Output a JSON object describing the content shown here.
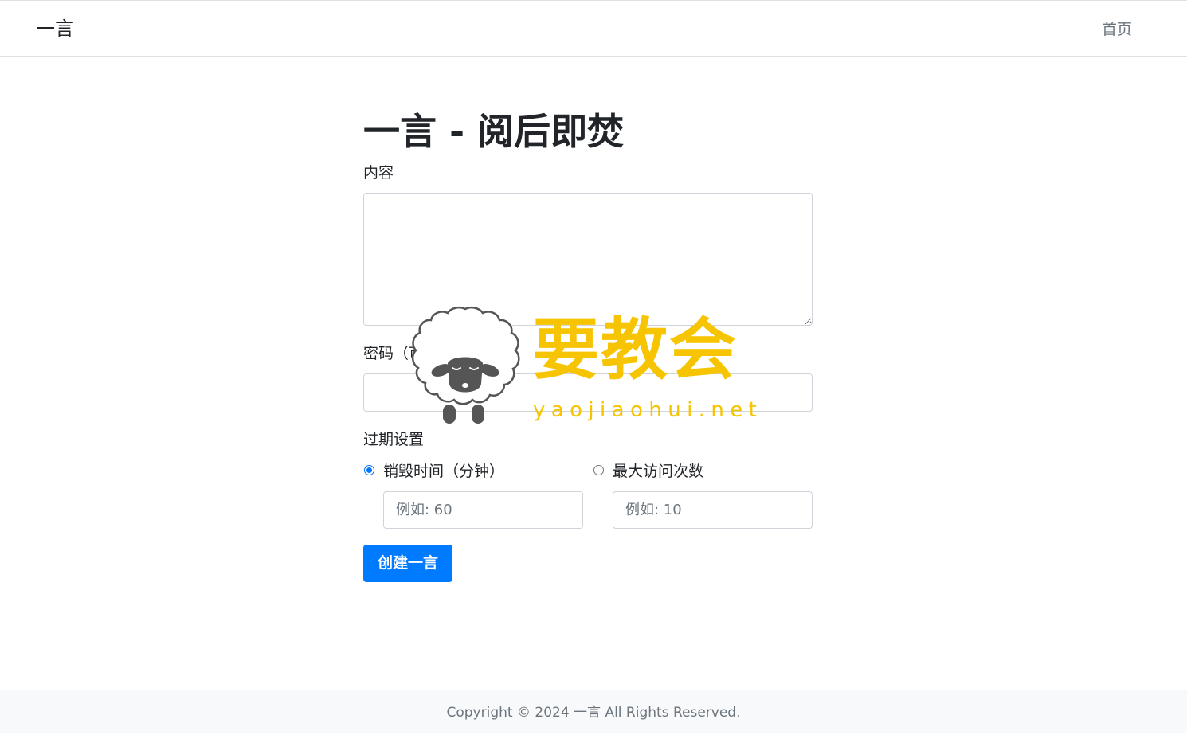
{
  "navbar": {
    "brand": "一言",
    "home_link": "首页"
  },
  "main": {
    "title": "一言 - 阅后即焚",
    "content_label": "内容",
    "content_value": "",
    "password_label": "密码（可选）",
    "password_value": "",
    "expiry_label": "过期设置",
    "option_time": {
      "label": "销毁时间（分钟）",
      "checked": true,
      "placeholder": "例如: 60"
    },
    "option_visits": {
      "label": "最大访问次数",
      "checked": false,
      "placeholder": "例如: 10"
    },
    "submit_label": "创建一言"
  },
  "watermark": {
    "text": "要教会",
    "url": "yaojiaohui.net"
  },
  "footer": {
    "copyright": "Copyright © 2024 一言 All Rights Reserved."
  },
  "colors": {
    "primary": "#007bff",
    "watermark": "#f6c400",
    "muted": "#6c757d",
    "border": "#ced4da"
  }
}
